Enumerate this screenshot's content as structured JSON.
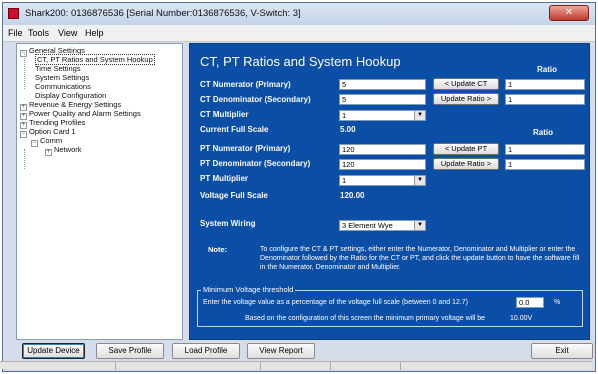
{
  "window": {
    "title": "Shark200: 0136876536 [Serial Number:0136876536, V-Switch: 3]",
    "close_label": "✕"
  },
  "menu": [
    "File",
    "Tools",
    "View",
    "Help"
  ],
  "tree": {
    "general_settings": "General Settings",
    "ct_pt": "CT, PT Ratios and System Hookup",
    "time_settings": "Time Settings",
    "system_settings": "System Settings",
    "communications": "Communications",
    "display_config": "Display Configuration",
    "revenue_energy": "Revenue & Energy Settings",
    "power_quality": "Power Quality and Alarm Settings",
    "trending": "Trending Profiles",
    "option_card": "Option Card 1",
    "comm": "Comm",
    "network": "Network"
  },
  "panel": {
    "title": "CT, PT Ratios and System Hookup",
    "ratio_header": "Ratio",
    "ct": {
      "numerator_label": "CT Numerator (Primary)",
      "numerator_value": "5",
      "denominator_label": "CT Denominator (Secondary)",
      "denominator_value": "5",
      "multiplier_label": "CT Multiplier",
      "multiplier_value": "1",
      "full_scale_label": "Current Full Scale",
      "full_scale_value": "5.00",
      "update_ct_button": "< Update CT",
      "update_ratio_button": "Update Ratio >",
      "ratio_top": "1",
      "ratio_bottom": "1"
    },
    "pt": {
      "numerator_label": "PT Numerator (Primary)",
      "numerator_value": "120",
      "denominator_label": "PT Denominator (Secondary)",
      "denominator_value": "120",
      "multiplier_label": "PT Multiplier",
      "multiplier_value": "1",
      "full_scale_label": "Voltage Full Scale",
      "full_scale_value": "120.00",
      "update_pt_button": "< Update PT",
      "update_ratio_button": "Update Ratio >",
      "ratio_top": "1",
      "ratio_bottom": "1"
    },
    "wiring": {
      "label": "System Wiring",
      "value": "3 Element Wye"
    },
    "note": {
      "label": "Note:",
      "text": "To configure the CT & PT settings, either enter the Numerator, Denominator and Multiplier or enter the Denominator followed by the Ratio for the CT or PT, and click the update button to have the software fill in the Numerator, Denominator and Multiplier."
    },
    "min_voltage": {
      "title": "Minimum Voltage threshold",
      "prompt": "Enter the voltage value as a percentage of the voltage full scale (between 0 and 12.7)",
      "value": "0.0",
      "unit": "%",
      "info": "Based on the configuration of this screen the minimum primary voltage will be",
      "computed": "10.00V"
    }
  },
  "buttons": {
    "update_device": "Update Device",
    "save_profile": "Save Profile",
    "load_profile": "Load Profile",
    "view_report": "View Report",
    "exit": "Exit"
  },
  "colors": {
    "panel_bg": "#0a4ea6",
    "window_bg": "#d4dde9"
  }
}
